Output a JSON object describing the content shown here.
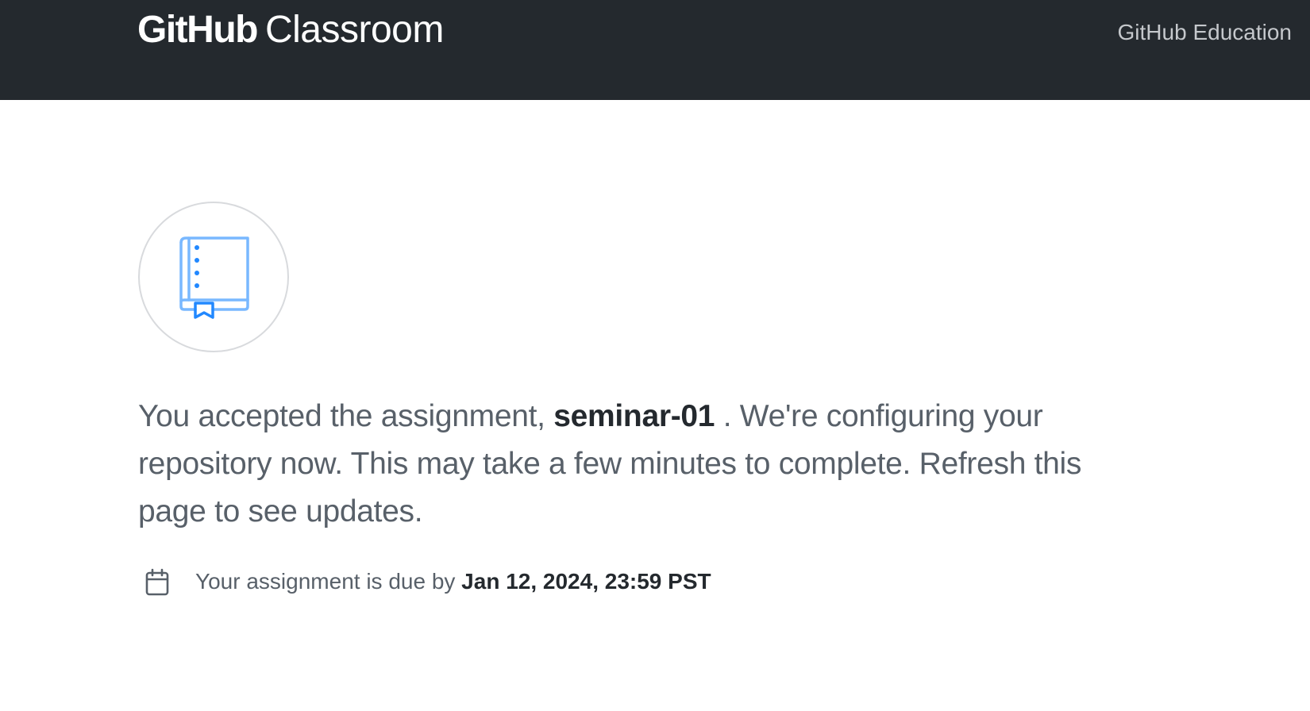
{
  "header": {
    "brand_strong": "GitHub",
    "brand_light": "Classroom",
    "education_link": "GitHub Education"
  },
  "main": {
    "icon": "repo-book-icon",
    "message": {
      "prefix": "You accepted the assignment, ",
      "assignment_name": "seminar-01",
      "suffix": " . We're configuring your repository now. This may take a few minutes to complete. Refresh this page to see updates."
    },
    "due": {
      "icon": "calendar-icon",
      "label": "Your assignment is due by",
      "date": "Jan 12, 2024, 23:59 PST"
    }
  },
  "colors": {
    "header_bg": "#24292e",
    "icon_light": "#79b8ff",
    "icon_dark": "#2188ff",
    "text_muted": "#586069",
    "text_strong": "#24292e"
  }
}
